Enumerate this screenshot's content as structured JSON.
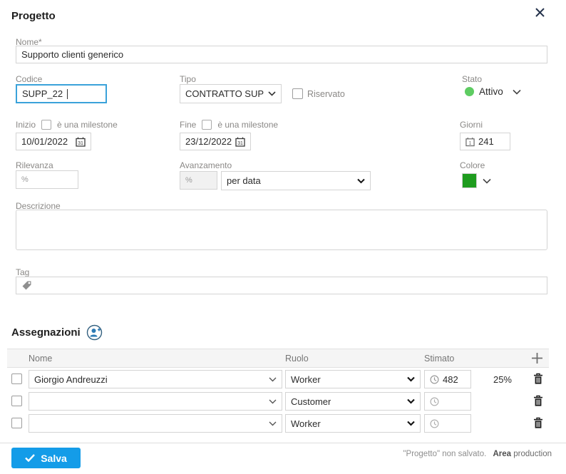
{
  "modal": {
    "title": "Progetto"
  },
  "icons": {
    "close": "✕",
    "check": "✓",
    "plus": "+",
    "percent": "%"
  },
  "form": {
    "nome": {
      "label": "Nome*",
      "value": "Supporto clienti generico"
    },
    "codice": {
      "label": "Codice",
      "value": "SUPP_22"
    },
    "tipo": {
      "label": "Tipo",
      "value": "CONTRATTO SUPPO"
    },
    "riservato": {
      "label": "Riservato",
      "checked": false
    },
    "stato": {
      "label": "Stato",
      "value": "Attivo",
      "color": "#5ecc62"
    },
    "inizio": {
      "label": "Inizio",
      "milestone_label": "è una milestone",
      "value": "10/01/2022",
      "cal_day": "31"
    },
    "fine": {
      "label": "Fine",
      "milestone_label": "è una milestone",
      "value": "23/12/2022",
      "cal_day": "31"
    },
    "giorni": {
      "label": "Giorni",
      "value": "241",
      "cal_day": "1"
    },
    "rilevanza": {
      "label": "Rilevanza",
      "prefix": "%",
      "value": ""
    },
    "avanzamento": {
      "label": "Avanzamento",
      "prefix": "%",
      "mode": "per data"
    },
    "colore": {
      "label": "Colore",
      "value": "#1e9c1e"
    },
    "descrizione": {
      "label": "Descrizione",
      "value": ""
    },
    "tag": {
      "label": "Tag",
      "value": ""
    }
  },
  "assegnazioni": {
    "title": "Assegnazioni",
    "columns": {
      "nome": "Nome",
      "ruolo": "Ruolo",
      "stimato": "Stimato"
    },
    "rows": [
      {
        "nome": "Giorgio Andreuzzi",
        "ruolo": "Worker",
        "stimato": "482",
        "percent": "25%"
      },
      {
        "nome": "",
        "ruolo": "Customer",
        "stimato": "",
        "percent": ""
      },
      {
        "nome": "",
        "ruolo": "Worker",
        "stimato": "",
        "percent": ""
      }
    ]
  },
  "footer": {
    "save_label": "Salva",
    "status_unsaved": "\"Progetto\" non salvato.",
    "area_label": "Area",
    "area_value": "production"
  }
}
